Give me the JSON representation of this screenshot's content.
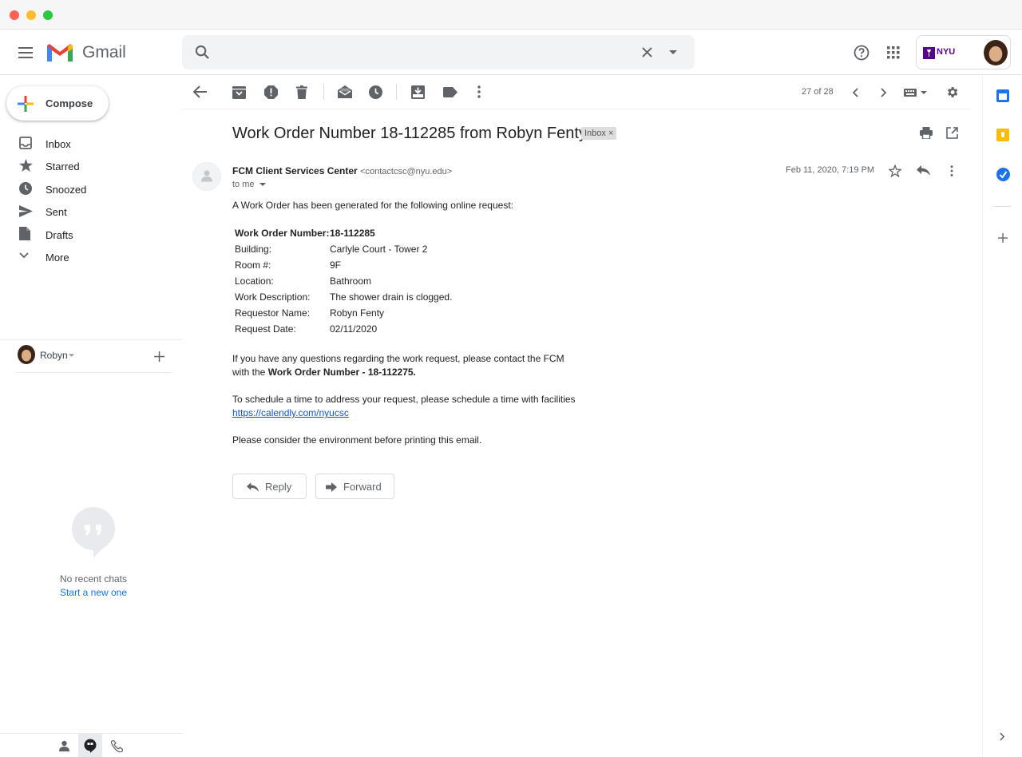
{
  "app": {
    "name": "Gmail",
    "org_badge": "NYU"
  },
  "search": {
    "placeholder": ""
  },
  "sidebar": {
    "compose_label": "Compose",
    "items": [
      {
        "label": "Inbox",
        "icon": "inbox-icon"
      },
      {
        "label": "Starred",
        "icon": "star-icon"
      },
      {
        "label": "Snoozed",
        "icon": "clock-icon"
      },
      {
        "label": "Sent",
        "icon": "send-icon"
      },
      {
        "label": "Drafts",
        "icon": "draft-icon"
      },
      {
        "label": "More",
        "icon": "chevron-down-icon"
      }
    ],
    "hangouts": {
      "user": "Robyn",
      "empty_text": "No recent chats",
      "start_link": "Start a new one"
    }
  },
  "toolbar": {
    "pagination": "27 of 28"
  },
  "email": {
    "subject": "Work Order Number 18-112285 from Robyn Fenty",
    "label_badge": "Inbox",
    "badge_close": "×",
    "sender_name": "FCM Client Services Center",
    "sender_email": "<contactcsc@nyu.edu>",
    "recipient": "to me",
    "date": "Feb 11, 2020, 7:19 PM",
    "intro": "A Work Order has been generated for the following online request:",
    "details": [
      {
        "label": "Work Order Number:",
        "value": "18-112285",
        "bold": true
      },
      {
        "label": "Building:",
        "value": "Carlyle Court - Tower 2"
      },
      {
        "label": "Room #:",
        "value": "9F"
      },
      {
        "label": "Location:",
        "value": "Bathroom"
      },
      {
        "label": "Work Description:",
        "value": "The shower drain is clogged."
      },
      {
        "label": "Requestor Name:",
        "value": "Robyn Fenty"
      },
      {
        "label": "Request Date:",
        "value": "02/11/2020"
      }
    ],
    "questions_line1": "If you have any questions regarding the work request, please contact the FCM",
    "questions_line2_prefix": "with the ",
    "questions_line2_bold": "Work Order Number - 18-112275.",
    "schedule_line": "To schedule a time to address your request, please schedule a time with facilities",
    "schedule_link": "https://calendly.com/nyucsc",
    "environment_line": "Please consider the environment before printing this email.",
    "reply_label": "Reply",
    "forward_label": "Forward"
  },
  "colors": {
    "accent_blue": "#1a73e8",
    "link_blue": "#1155cc",
    "nyu_purple": "#57068c",
    "gmail_red": "#ea4335"
  }
}
